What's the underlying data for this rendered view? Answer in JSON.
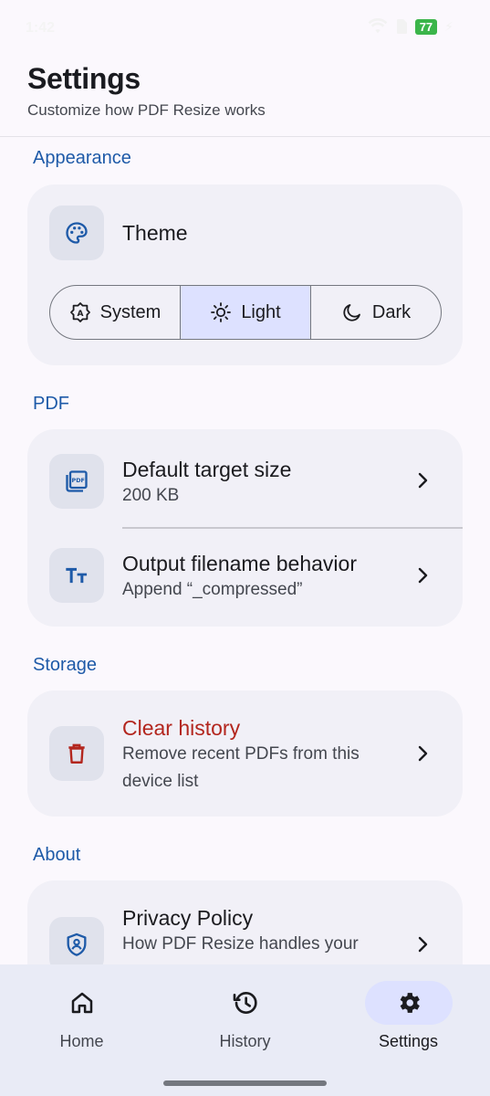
{
  "status_bar": {
    "time": "1:42",
    "battery": "77"
  },
  "header": {
    "title": "Settings",
    "subtitle": "Customize how PDF Resize works"
  },
  "sections": {
    "appearance": {
      "title": "Appearance",
      "theme_label": "Theme",
      "theme_options": [
        "System",
        "Light",
        "Dark"
      ],
      "selected": "Light"
    },
    "pdf": {
      "title": "PDF",
      "default_target_size": {
        "label": "Default target size",
        "value": "200 KB"
      },
      "output_filename": {
        "label": "Output filename behavior",
        "value": "Append “_compressed”"
      }
    },
    "storage": {
      "title": "Storage",
      "clear_history": {
        "label": "Clear history",
        "line1": "Remove recent PDFs from this",
        "line2": "device list"
      }
    },
    "about": {
      "title": "About",
      "privacy": {
        "label": "Privacy Policy",
        "value": "How PDF Resize handles your"
      }
    }
  },
  "bottom_nav": {
    "items": [
      {
        "label": "Home",
        "icon": "home-icon"
      },
      {
        "label": "History",
        "icon": "history-icon"
      },
      {
        "label": "Settings",
        "icon": "gear-icon"
      }
    ],
    "active": "Settings"
  },
  "colors": {
    "accent": "#1e5aa8",
    "danger": "#b3261e",
    "selected_segment": "#dde1ff",
    "card": "#f1f0f7"
  }
}
